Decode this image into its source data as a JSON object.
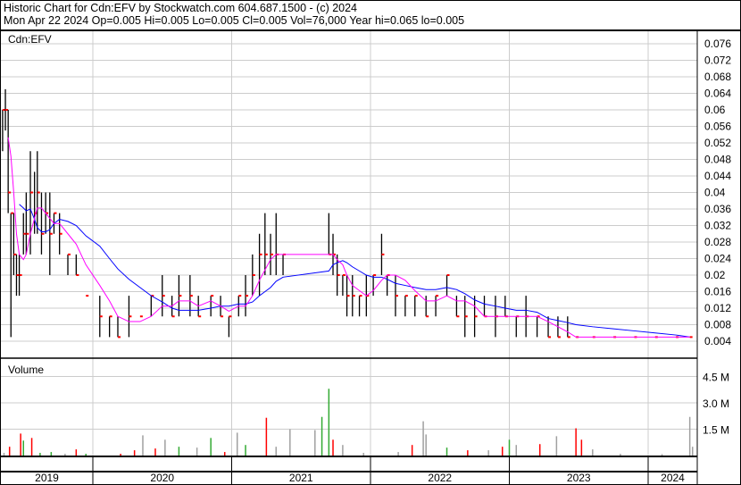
{
  "header": {
    "title": "Historic Chart for Cdn:EFV by Stockwatch.com 604.687.1500 - (c) 2024",
    "quote": "Mon Apr 22 2024  Op=0.005  Hi=0.005  Lo=0.005  Cl=0.005  Vol=76,000  Year hi=0.065  lo=0.005"
  },
  "chart_data": [
    {
      "type": "bar",
      "subtype": "ohlc",
      "title": "Cdn:EFV",
      "ylim": [
        0,
        0.08
      ],
      "yticks": [
        "0.004",
        "0.008",
        "0.012",
        "0.016",
        "0.02",
        "0.024",
        "0.028",
        "0.032",
        "0.036",
        "0.04",
        "0.044",
        "0.048",
        "0.052",
        "0.056",
        "0.06",
        "0.064",
        "0.068",
        "0.072",
        "0.076"
      ],
      "xlim": [
        2019.34,
        2024.36
      ],
      "xticks": [
        "2019",
        "2020",
        "2021",
        "2022",
        "2023",
        "2024"
      ],
      "series_colors": {
        "bar": "#000000",
        "close": "#ff0000",
        "ma_long": "#0000ff",
        "ma_short": "#ff00ff"
      },
      "bars": [
        [
          2019.35,
          0.06,
          0.05,
          0.06
        ],
        [
          2019.37,
          0.065,
          0.055,
          0.06
        ],
        [
          2019.39,
          0.06,
          0.035,
          0.04
        ],
        [
          2019.41,
          0.035,
          0.005,
          0.035
        ],
        [
          2019.43,
          0.035,
          0.02,
          0.025
        ],
        [
          2019.45,
          0.025,
          0.015,
          0.02
        ],
        [
          2019.47,
          0.025,
          0.015,
          0.02
        ],
        [
          2019.5,
          0.035,
          0.025,
          0.03
        ],
        [
          2019.52,
          0.04,
          0.025,
          0.03
        ],
        [
          2019.55,
          0.05,
          0.025,
          0.04
        ],
        [
          2019.58,
          0.045,
          0.03,
          0.035
        ],
        [
          2019.6,
          0.05,
          0.03,
          0.04
        ],
        [
          2019.63,
          0.04,
          0.025,
          0.03
        ],
        [
          2019.66,
          0.04,
          0.03,
          0.035
        ],
        [
          2019.69,
          0.04,
          0.02,
          0.03
        ],
        [
          2019.72,
          0.035,
          0.03,
          0.035
        ],
        [
          2019.76,
          0.035,
          0.025,
          0.03
        ],
        [
          2019.82,
          0.025,
          0.02,
          0.025
        ],
        [
          2019.88,
          0.025,
          0.02,
          0.02
        ],
        [
          2019.95,
          0.015,
          0.015,
          0.015
        ],
        [
          2020.05,
          0.015,
          0.005,
          0.01
        ],
        [
          2020.12,
          0.01,
          0.005,
          0.01
        ],
        [
          2020.18,
          0.01,
          0.005,
          0.005
        ],
        [
          2020.26,
          0.015,
          0.005,
          0.01
        ],
        [
          2020.34,
          0.01,
          0.01,
          0.01
        ],
        [
          2020.42,
          0.015,
          0.01,
          0.015
        ],
        [
          2020.5,
          0.02,
          0.01,
          0.015
        ],
        [
          2020.57,
          0.015,
          0.01,
          0.01
        ],
        [
          2020.62,
          0.02,
          0.01,
          0.015
        ],
        [
          2020.7,
          0.02,
          0.01,
          0.015
        ],
        [
          2020.76,
          0.015,
          0.01,
          0.01
        ],
        [
          2020.85,
          0.015,
          0.01,
          0.015
        ],
        [
          2020.92,
          0.015,
          0.01,
          0.01
        ],
        [
          2020.98,
          0.01,
          0.005,
          0.01
        ],
        [
          2021.05,
          0.015,
          0.01,
          0.015
        ],
        [
          2021.1,
          0.02,
          0.01,
          0.015
        ],
        [
          2021.15,
          0.025,
          0.015,
          0.02
        ],
        [
          2021.2,
          0.03,
          0.015,
          0.025
        ],
        [
          2021.24,
          0.035,
          0.02,
          0.025
        ],
        [
          2021.28,
          0.03,
          0.02,
          0.025
        ],
        [
          2021.32,
          0.035,
          0.02,
          0.025
        ],
        [
          2021.37,
          0.025,
          0.02,
          0.025
        ],
        [
          2021.7,
          0.035,
          0.025,
          0.025
        ],
        [
          2021.73,
          0.03,
          0.02,
          0.025
        ],
        [
          2021.76,
          0.025,
          0.015,
          0.02
        ],
        [
          2021.8,
          0.02,
          0.015,
          0.02
        ],
        [
          2021.83,
          0.02,
          0.01,
          0.015
        ],
        [
          2021.87,
          0.02,
          0.01,
          0.015
        ],
        [
          2021.92,
          0.015,
          0.01,
          0.015
        ],
        [
          2021.97,
          0.02,
          0.01,
          0.015
        ],
        [
          2022.02,
          0.02,
          0.015,
          0.02
        ],
        [
          2022.08,
          0.03,
          0.02,
          0.025
        ],
        [
          2022.12,
          0.02,
          0.015,
          0.02
        ],
        [
          2022.18,
          0.02,
          0.01,
          0.015
        ],
        [
          2022.25,
          0.015,
          0.01,
          0.015
        ],
        [
          2022.32,
          0.015,
          0.01,
          0.015
        ],
        [
          2022.4,
          0.015,
          0.01,
          0.01
        ],
        [
          2022.47,
          0.015,
          0.01,
          0.015
        ],
        [
          2022.55,
          0.02,
          0.015,
          0.02
        ],
        [
          2022.62,
          0.015,
          0.01,
          0.01
        ],
        [
          2022.68,
          0.015,
          0.005,
          0.01
        ],
        [
          2022.75,
          0.015,
          0.005,
          0.01
        ],
        [
          2022.82,
          0.015,
          0.01,
          0.01
        ],
        [
          2022.9,
          0.015,
          0.005,
          0.01
        ],
        [
          2022.97,
          0.015,
          0.01,
          0.01
        ],
        [
          2023.05,
          0.01,
          0.005,
          0.01
        ],
        [
          2023.12,
          0.015,
          0.005,
          0.01
        ],
        [
          2023.2,
          0.01,
          0.005,
          0.01
        ],
        [
          2023.28,
          0.01,
          0.005,
          0.005
        ],
        [
          2023.35,
          0.01,
          0.005,
          0.005
        ],
        [
          2023.42,
          0.01,
          0.005,
          0.005
        ],
        [
          2023.48,
          0.005,
          0.005,
          0.005
        ],
        [
          2023.6,
          0.005,
          0.005,
          0.005
        ],
        [
          2023.75,
          0.005,
          0.005,
          0.005
        ],
        [
          2023.9,
          0.005,
          0.005,
          0.005
        ],
        [
          2024.05,
          0.005,
          0.005,
          0.005
        ],
        [
          2024.2,
          0.005,
          0.005,
          0.005
        ],
        [
          2024.3,
          0.005,
          0.005,
          0.005
        ]
      ]
    },
    {
      "type": "bar",
      "title": "Volume",
      "yticks": [
        "1.5 M",
        "3.0 M",
        "4.5 M"
      ],
      "ylim": [
        0,
        5400000
      ],
      "volumes": [
        [
          2019.36,
          150000,
          "gray"
        ],
        [
          2019.4,
          500000,
          "red"
        ],
        [
          2019.48,
          1250000,
          "red"
        ],
        [
          2019.5,
          850000,
          "green"
        ],
        [
          2019.56,
          1000000,
          "red"
        ],
        [
          2019.62,
          150000,
          "green"
        ],
        [
          2019.7,
          200000,
          "green"
        ],
        [
          2019.8,
          100000,
          "gray"
        ],
        [
          2019.88,
          350000,
          "red"
        ],
        [
          2019.95,
          100000,
          "green"
        ],
        [
          2020.2,
          100000,
          "red"
        ],
        [
          2020.3,
          300000,
          "red"
        ],
        [
          2020.36,
          1150000,
          "gray"
        ],
        [
          2020.45,
          400000,
          "red"
        ],
        [
          2020.52,
          900000,
          "gray"
        ],
        [
          2020.62,
          500000,
          "green"
        ],
        [
          2020.75,
          450000,
          "gray"
        ],
        [
          2020.85,
          1000000,
          "green"
        ],
        [
          2020.95,
          200000,
          "red"
        ],
        [
          2021.04,
          1300000,
          "gray"
        ],
        [
          2021.1,
          600000,
          "green"
        ],
        [
          2021.25,
          2150000,
          "red"
        ],
        [
          2021.32,
          500000,
          "gray"
        ],
        [
          2021.42,
          1500000,
          "gray"
        ],
        [
          2021.6,
          1450000,
          "gray"
        ],
        [
          2021.65,
          2200000,
          "green"
        ],
        [
          2021.7,
          3800000,
          "green"
        ],
        [
          2021.73,
          900000,
          "red"
        ],
        [
          2021.8,
          600000,
          "gray"
        ],
        [
          2021.95,
          150000,
          "gray"
        ],
        [
          2022.2,
          200000,
          "gray"
        ],
        [
          2022.3,
          600000,
          "red"
        ],
        [
          2022.38,
          1950000,
          "gray"
        ],
        [
          2022.4,
          1200000,
          "gray"
        ],
        [
          2022.55,
          450000,
          "green"
        ],
        [
          2022.7,
          300000,
          "red"
        ],
        [
          2022.85,
          300000,
          "gray"
        ],
        [
          2022.95,
          500000,
          "red"
        ],
        [
          2023.0,
          900000,
          "green"
        ],
        [
          2023.05,
          600000,
          "gray"
        ],
        [
          2023.22,
          650000,
          "red"
        ],
        [
          2023.34,
          1100000,
          "gray"
        ],
        [
          2023.48,
          1550000,
          "red"
        ],
        [
          2023.52,
          900000,
          "red"
        ],
        [
          2023.6,
          350000,
          "gray"
        ],
        [
          2023.8,
          100000,
          "gray"
        ],
        [
          2024.1,
          80000,
          "gray"
        ],
        [
          2024.3,
          2200000,
          "gray"
        ],
        [
          2024.32,
          500000,
          "gray"
        ]
      ]
    }
  ]
}
